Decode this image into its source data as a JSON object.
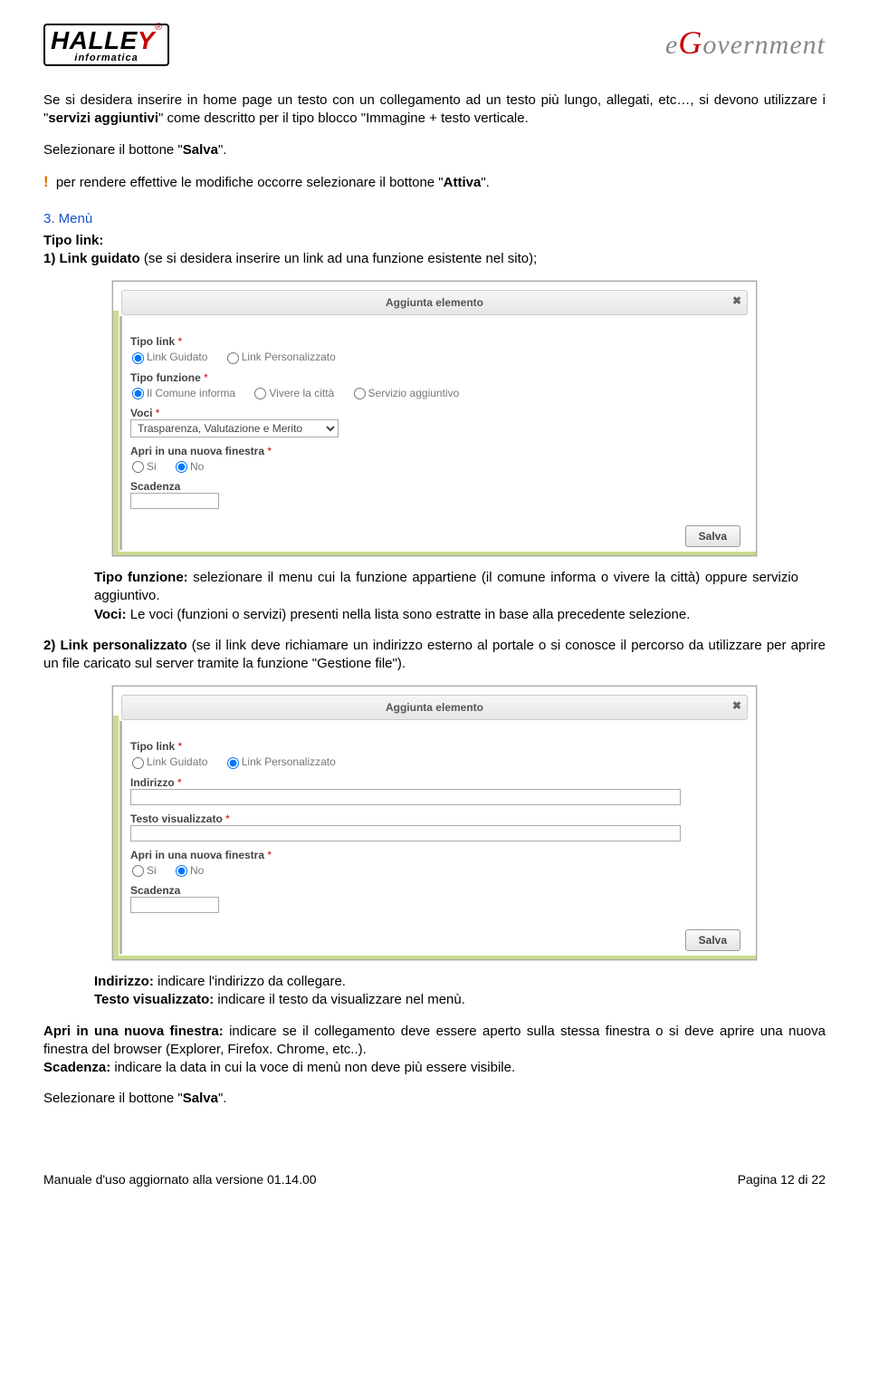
{
  "header": {
    "logo_main": "HALLE",
    "logo_last": "Y",
    "logo_reg": "®",
    "logo_sub": "informatica",
    "egov_e": "e",
    "egov_g": "G",
    "egov_rest": "overnment"
  },
  "intro": {
    "p1_a": "Se si desidera inserire in home page un testo con un collegamento ad un testo più lungo, allegati, etc…, si devono utilizzare i \"",
    "p1_b": "servizi aggiuntivi",
    "p1_c": "\" come descritto per il tipo blocco \"Immagine + testo verticale.",
    "p2_a": "Selezionare il bottone \"",
    "p2_b": "Salva",
    "p2_c": "\".",
    "p3_a": "per rendere effettive le modifiche occorre selezionare il bottone \"",
    "p3_b": "Attiva",
    "p3_c": "\"."
  },
  "section3": {
    "heading": "3. Menù",
    "tipo_link_label": "Tipo link:",
    "line1_a": "1) Link guidato",
    "line1_b": " (se si desidera inserire un link ad una funzione esistente nel sito);"
  },
  "dialog1": {
    "title": "Aggiunta elemento",
    "tipo_link": "Tipo link",
    "opt_guidato": "Link Guidato",
    "opt_personalizzato": "Link Personalizzato",
    "tipo_funzione": "Tipo funzione",
    "opt_comune": "Il Comune informa",
    "opt_vivere": "Vivere la città",
    "opt_servizio": "Servizio aggiuntivo",
    "voci": "Voci",
    "voci_value": "Trasparenza, Valutazione e Merito",
    "apri": "Apri in una nuova finestra",
    "si": "Si",
    "no": "No",
    "scadenza": "Scadenza",
    "salva": "Salva"
  },
  "after1": {
    "tf_label": "Tipo funzione:",
    "tf_text": " selezionare il menu cui la funzione appartiene (il comune informa o vivere la città) oppure servizio aggiuntivo.",
    "voci_label": "Voci:",
    "voci_text": " Le voci (funzioni o servizi) presenti nella lista sono estratte in base alla precedente selezione.",
    "lp_a": "2) Link personalizzato",
    "lp_b": " (se il link deve richiamare un indirizzo esterno al portale o si conosce il percorso da utilizzare per aprire un file caricato sul server tramite la funzione \"Gestione file\")."
  },
  "dialog2": {
    "title": "Aggiunta elemento",
    "tipo_link": "Tipo link",
    "opt_guidato": "Link Guidato",
    "opt_personalizzato": "Link Personalizzato",
    "indirizzo": "Indirizzo",
    "testo_vis": "Testo visualizzato",
    "apri": "Apri in una nuova finestra",
    "si": "Si",
    "no": "No",
    "scadenza": "Scadenza",
    "salva": "Salva"
  },
  "after2": {
    "ind_label": "Indirizzo:",
    "ind_text": " indicare l'indirizzo da collegare.",
    "tv_label": "Testo visualizzato:",
    "tv_text": " indicare il testo da visualizzare nel menù.",
    "apri_label": "Apri in una nuova finestra:",
    "apri_text": " indicare se il collegamento deve essere aperto sulla stessa finestra o si deve aprire una nuova finestra del browser (Explorer, Firefox. Chrome, etc..).",
    "scad_label": "Scadenza:",
    "scad_text": " indicare la data in cui la voce di menù non deve più essere visibile.",
    "salva_a": "Selezionare il bottone \"",
    "salva_b": "Salva",
    "salva_c": "\"."
  },
  "footer": {
    "left": "Manuale d'uso aggiornato alla versione 01.14.00",
    "right": "Pagina 12 di 22"
  }
}
